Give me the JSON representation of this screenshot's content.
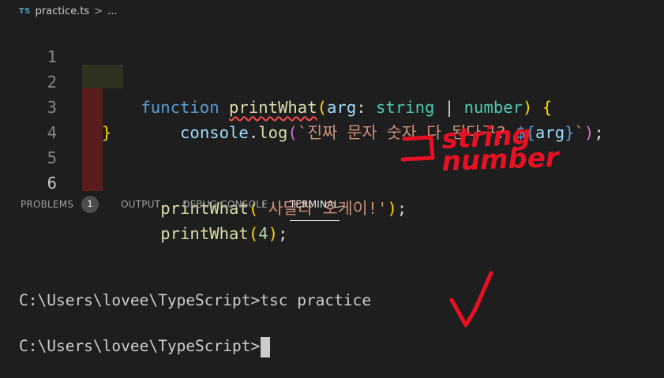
{
  "breadcrumb": {
    "language_badge": "TS",
    "filename": "practice.ts",
    "separator": ">",
    "ellipsis": "..."
  },
  "editor": {
    "line_numbers": [
      "1",
      "2",
      "3",
      "4",
      "5",
      "6"
    ],
    "line1": {
      "keyword": "function",
      "fn_name": "printWhat",
      "open_paren": "(",
      "param": "arg",
      "colon": ": ",
      "type1": "string",
      "union": " | ",
      "type2": "number",
      "close_paren": ")",
      "brace": " {"
    },
    "line2": {
      "indent": "    ",
      "object": "console",
      "dot": ".",
      "method": "log",
      "open_paren": "(",
      "tmpl_open": "`진짜 문자 숫자 다 된다구? ",
      "interp_open": "${",
      "interp_var": "arg",
      "interp_close": "}",
      "tmpl_close": "`",
      "close_paren": ")",
      "semi": ";"
    },
    "line3": {
      "indent": "  ",
      "brace": "}"
    },
    "line5": {
      "indent": "  ",
      "fn": "printWhat",
      "open_paren": "(",
      "arg": "'사달라 오케이!'",
      "close_paren": ")",
      "semi": ";"
    },
    "line6": {
      "indent": "  ",
      "fn": "printWhat",
      "open_paren": "(",
      "arg": "4",
      "close_paren": ")",
      "semi": ";"
    }
  },
  "panel": {
    "tabs": [
      "PROBLEMS",
      "OUTPUT",
      "DEBUG CONSOLE",
      "TERMINAL"
    ],
    "problems_count": "1",
    "active_tab": "TERMINAL"
  },
  "terminal": {
    "line1": "C:\\Users\\lovee\\TypeScript>tsc practice",
    "line2": "C:\\Users\\lovee\\TypeScript>"
  },
  "annotation": {
    "word1": "string",
    "word2": "number",
    "color": "#e81123"
  }
}
